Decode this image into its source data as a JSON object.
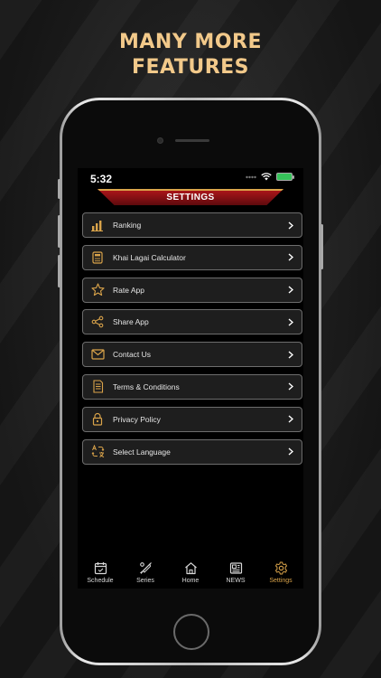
{
  "promo": {
    "line1": "MANY MORE",
    "line2": "FEATURES"
  },
  "status_bar": {
    "time": "5:32"
  },
  "header": {
    "title": "SETTINGS"
  },
  "menu": {
    "items": [
      {
        "label": "Ranking",
        "icon": "bar-chart-icon"
      },
      {
        "label": "Khai Lagai Calculator",
        "icon": "calculator-icon"
      },
      {
        "label": "Rate App",
        "icon": "star-icon"
      },
      {
        "label": "Share App",
        "icon": "share-icon"
      },
      {
        "label": "Contact Us",
        "icon": "mail-icon"
      },
      {
        "label": "Terms & Conditions",
        "icon": "document-icon"
      },
      {
        "label": "Privacy Policy",
        "icon": "lock-icon"
      },
      {
        "label": "Select Language",
        "icon": "translate-icon"
      }
    ]
  },
  "tabbar": {
    "tabs": [
      {
        "label": "Schedule",
        "icon": "calendar-icon"
      },
      {
        "label": "Series",
        "icon": "cricket-bat-icon"
      },
      {
        "label": "Home",
        "icon": "home-icon"
      },
      {
        "label": "NEWS",
        "icon": "newspaper-icon"
      },
      {
        "label": "Settings",
        "icon": "gear-icon",
        "active": true
      }
    ]
  },
  "colors": {
    "accent_gold": "#d9a34a",
    "banner_red": "#b3161b",
    "headline": "#f2c98a"
  }
}
